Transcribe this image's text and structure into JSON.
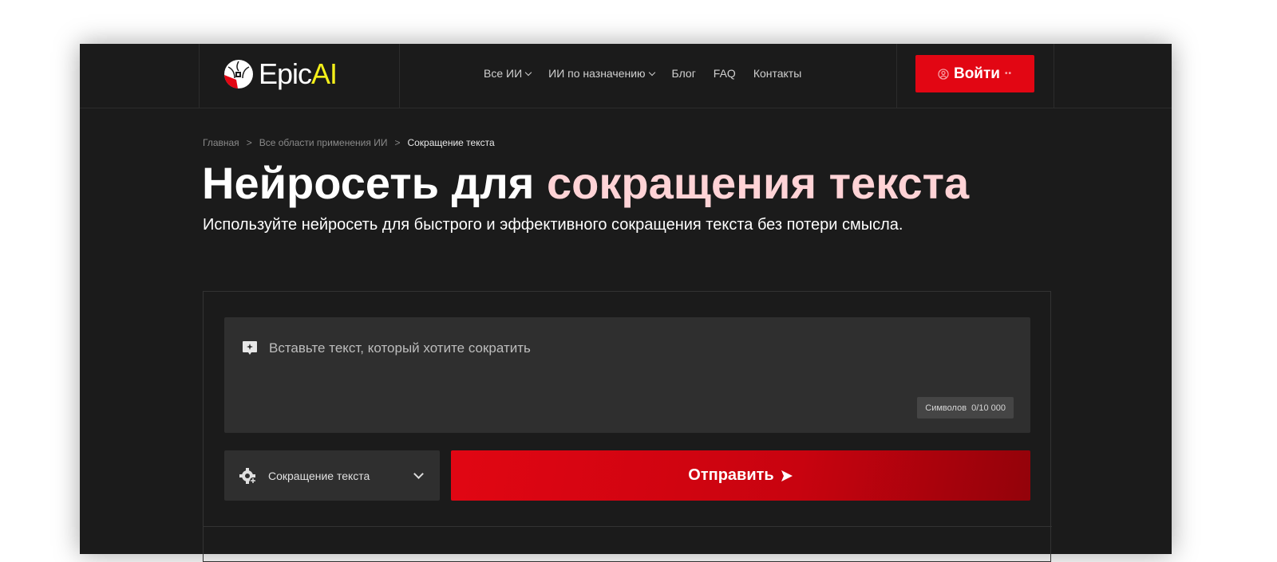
{
  "header": {
    "logo_text": "Epic",
    "logo_accent": "AI",
    "nav": [
      {
        "label": "Все ИИ",
        "dropdown": true
      },
      {
        "label": "ИИ по назначению",
        "dropdown": true
      },
      {
        "label": "Блог",
        "dropdown": false
      },
      {
        "label": "FAQ",
        "dropdown": false
      },
      {
        "label": "Контакты",
        "dropdown": false
      }
    ],
    "login_label": "Войти",
    "login_dots": "••"
  },
  "breadcrumb": {
    "items": [
      "Главная",
      "Все области применения ИИ",
      "Сокращение текста"
    ],
    "separator": ">"
  },
  "hero": {
    "title_white": "Нейросеть для ",
    "title_pink": "сокращения текста",
    "subtitle": "Используйте нейросеть для быстрого и эффективного сокращения текста без потери смысла."
  },
  "form": {
    "placeholder": "Вставьте текст, который хотите сократить",
    "counter_label": "Символов",
    "counter_value": "0/10 000",
    "mode_value": "Сокращение текста",
    "submit_label": "Отправить"
  },
  "colors": {
    "accent": "#e20613",
    "logo_yellow": "#f4ef1a",
    "bg": "#1b1b1b"
  }
}
